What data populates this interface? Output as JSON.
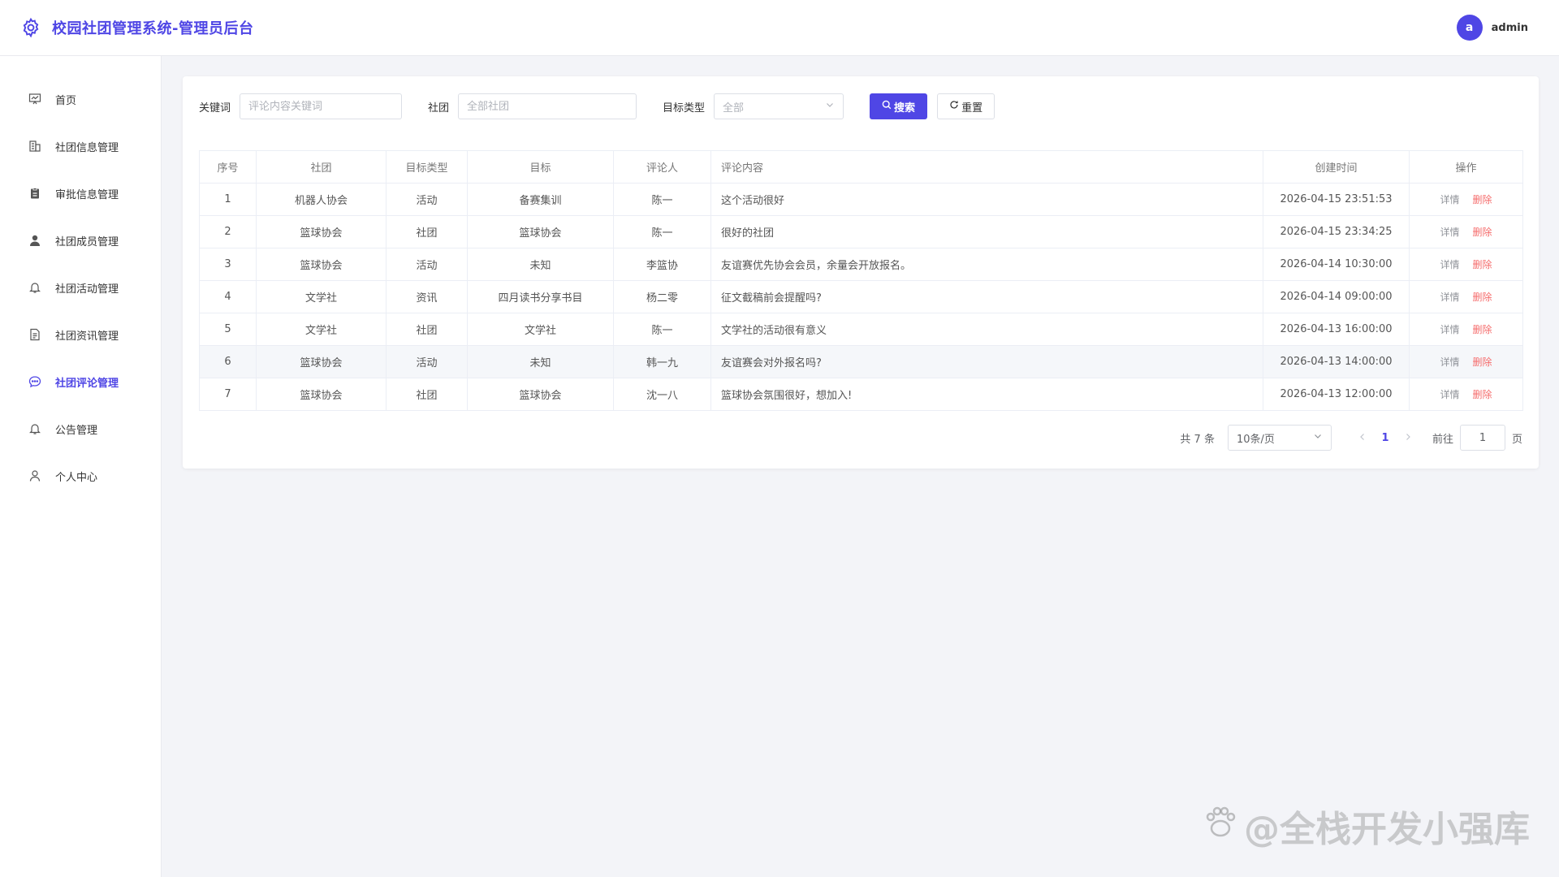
{
  "app": {
    "title": "校园社团管理系统-管理员后台",
    "logo_icon": "gear-icon"
  },
  "user": {
    "avatar_letter": "a",
    "name": "admin"
  },
  "colors": {
    "accent": "#4f46e5",
    "danger": "#f56c6c"
  },
  "sidebar": {
    "items": [
      {
        "label": "首页",
        "icon": "dashboard-icon",
        "active": false
      },
      {
        "label": "社团信息管理",
        "icon": "building-icon",
        "active": false
      },
      {
        "label": "审批信息管理",
        "icon": "clipboard-icon",
        "active": false
      },
      {
        "label": "社团成员管理",
        "icon": "user-icon",
        "active": false
      },
      {
        "label": "社团活动管理",
        "icon": "bell-icon",
        "active": false
      },
      {
        "label": "社团资讯管理",
        "icon": "document-icon",
        "active": false
      },
      {
        "label": "社团评论管理",
        "icon": "chat-icon",
        "active": true
      },
      {
        "label": "公告管理",
        "icon": "bell-icon",
        "active": false
      },
      {
        "label": "个人中心",
        "icon": "person-icon",
        "active": false
      }
    ]
  },
  "filters": {
    "keyword_label": "关键词",
    "keyword_placeholder": "评论内容关键词",
    "club_label": "社团",
    "club_placeholder": "全部社团",
    "type_label": "目标类型",
    "type_value": "全部",
    "search_label": "搜索",
    "reset_label": "重置"
  },
  "table": {
    "columns": [
      "序号",
      "社团",
      "目标类型",
      "目标",
      "评论人",
      "评论内容",
      "创建时间",
      "操作"
    ],
    "detail_label": "详情",
    "delete_label": "删除",
    "rows": [
      {
        "no": "1",
        "club": "机器人协会",
        "type": "活动",
        "target": "备赛集训",
        "author": "陈一",
        "content": "这个活动很好",
        "time": "2026-04-15 23:51:53"
      },
      {
        "no": "2",
        "club": "篮球协会",
        "type": "社团",
        "target": "篮球协会",
        "author": "陈一",
        "content": "很好的社团",
        "time": "2026-04-15 23:34:25"
      },
      {
        "no": "3",
        "club": "篮球协会",
        "type": "活动",
        "target": "未知",
        "author": "李篮协",
        "content": "友谊赛优先协会会员，余量会开放报名。",
        "time": "2026-04-14 10:30:00"
      },
      {
        "no": "4",
        "club": "文学社",
        "type": "资讯",
        "target": "四月读书分享书目",
        "author": "杨二零",
        "content": "征文截稿前会提醒吗?",
        "time": "2026-04-14 09:00:00"
      },
      {
        "no": "5",
        "club": "文学社",
        "type": "社团",
        "target": "文学社",
        "author": "陈一",
        "content": "文学社的活动很有意义",
        "time": "2026-04-13 16:00:00"
      },
      {
        "no": "6",
        "club": "篮球协会",
        "type": "活动",
        "target": "未知",
        "author": "韩一九",
        "content": "友谊赛会对外报名吗?",
        "time": "2026-04-13 14:00:00"
      },
      {
        "no": "7",
        "club": "篮球协会",
        "type": "社团",
        "target": "篮球协会",
        "author": "沈一八",
        "content": "篮球协会氛围很好，想加入!",
        "time": "2026-04-13 12:00:00"
      }
    ]
  },
  "pagination": {
    "total_text": "共 7 条",
    "page_size": "10条/页",
    "current_page": "1",
    "goto_label": "前往",
    "goto_value": "1",
    "page_unit": "页"
  },
  "watermark": {
    "text": "@全栈开发小强库"
  }
}
